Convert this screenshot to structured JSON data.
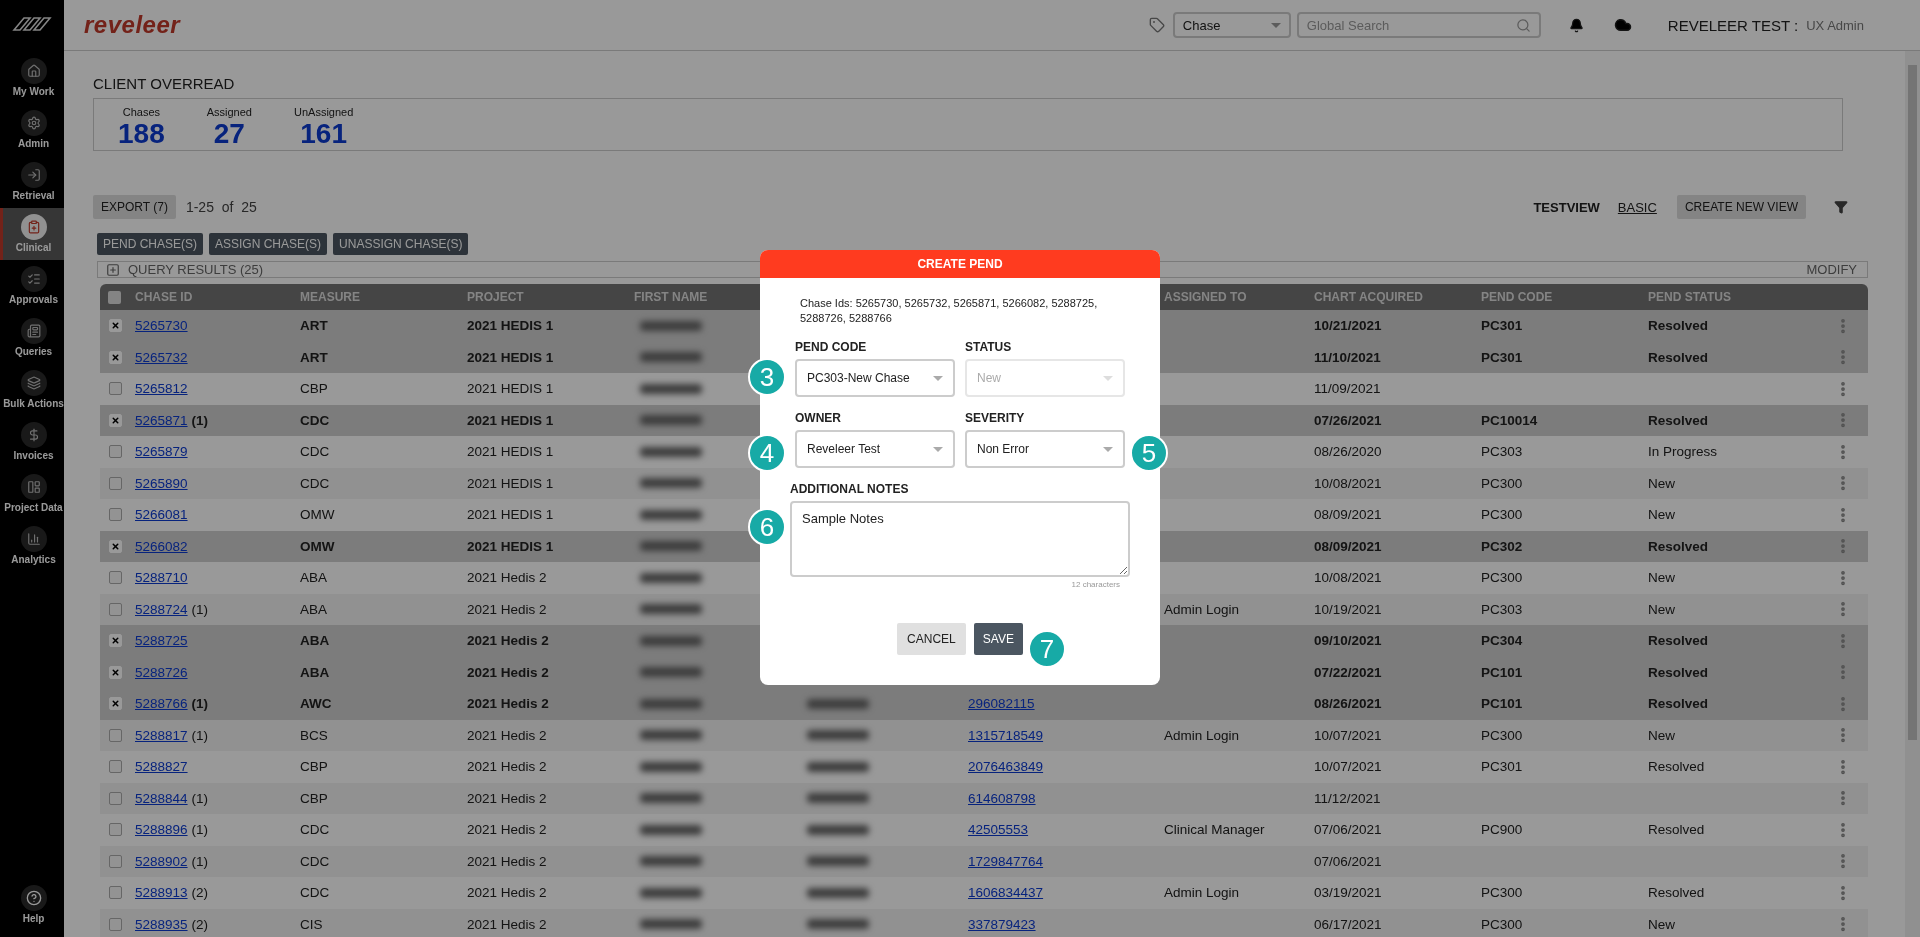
{
  "sidebar": {
    "items": [
      {
        "label": "My Work",
        "selected": false
      },
      {
        "label": "Admin",
        "selected": false
      },
      {
        "label": "Retrieval",
        "selected": false
      },
      {
        "label": "Clinical",
        "selected": true
      },
      {
        "label": "Approvals",
        "selected": false
      },
      {
        "label": "Queries",
        "selected": false
      },
      {
        "label": "Bulk Actions",
        "selected": false
      },
      {
        "label": "Invoices",
        "selected": false
      },
      {
        "label": "Project Data",
        "selected": false
      },
      {
        "label": "Analytics",
        "selected": false
      }
    ],
    "help": "Help"
  },
  "header": {
    "logo": "reveleer",
    "search_type": "Chase",
    "search_placeholder": "Global Search",
    "user": "REVELEER TEST :",
    "role": "UX Admin"
  },
  "page": {
    "title": "CLIENT OVERREAD",
    "stats": [
      {
        "label": "Chases",
        "value": "188"
      },
      {
        "label": "Assigned",
        "value": "27"
      },
      {
        "label": "UnAssigned",
        "value": "161"
      }
    ]
  },
  "toolbar": {
    "export": "EXPORT (7)",
    "range": "1-25  of  25",
    "view_name": "TESTVIEW",
    "view_link": "BASIC",
    "create_view": "CREATE NEW VIEW"
  },
  "actions": [
    "PEND CHASE(S)",
    "ASSIGN CHASE(S)",
    "UNASSIGN CHASE(S)"
  ],
  "query": {
    "title": "QUERY RESULTS (25)",
    "modify": "MODIFY"
  },
  "table": {
    "all_selected": false,
    "columns": [
      "CHASE ID",
      "MEASURE",
      "PROJECT",
      "FIRST NAME",
      "ASSIGNED TO",
      "CHART ACQUIRED",
      "PEND CODE",
      "PEND STATUS"
    ],
    "rows": [
      {
        "id": "5265730",
        "measure": "ART",
        "project": "2021 HEDIS 1",
        "chart": "10/21/2021",
        "pend_code": "PC301",
        "pend_status": "Resolved",
        "selected": true,
        "covered": true
      },
      {
        "id": "5265732",
        "measure": "ART",
        "project": "2021 HEDIS 1",
        "chart": "11/10/2021",
        "pend_code": "PC301",
        "pend_status": "Resolved",
        "selected": true,
        "covered": true
      },
      {
        "id": "5265812",
        "measure": "CBP",
        "project": "2021 HEDIS 1",
        "chart": "11/09/2021",
        "selected": false,
        "covered": true
      },
      {
        "id": "5265871",
        "count": "(1)",
        "measure": "CDC",
        "project": "2021 HEDIS 1",
        "chart": "07/26/2021",
        "pend_code": "PC10014",
        "pend_status": "Resolved",
        "selected": true,
        "covered": true
      },
      {
        "id": "5265879",
        "measure": "CDC",
        "project": "2021 HEDIS 1",
        "chart": "08/26/2020",
        "pend_code": "PC303",
        "pend_status": "In Progress",
        "selected": false,
        "covered": true
      },
      {
        "id": "5265890",
        "measure": "CDC",
        "project": "2021 HEDIS 1",
        "chart": "10/08/2021",
        "pend_code": "PC300",
        "pend_status": "New",
        "selected": false,
        "covered": true
      },
      {
        "id": "5266081",
        "measure": "OMW",
        "project": "2021 HEDIS 1",
        "chart": "08/09/2021",
        "pend_code": "PC300",
        "pend_status": "New",
        "selected": false,
        "covered": true
      },
      {
        "id": "5266082",
        "measure": "OMW",
        "project": "2021 HEDIS 1",
        "chart": "08/09/2021",
        "pend_code": "PC302",
        "pend_status": "Resolved",
        "selected": true,
        "covered": true
      },
      {
        "id": "5288710",
        "measure": "ABA",
        "project": "2021 Hedis 2",
        "chart": "10/08/2021",
        "pend_code": "PC300",
        "pend_status": "New",
        "selected": false,
        "covered": true
      },
      {
        "id": "5288724",
        "count": "(1)",
        "measure": "ABA",
        "project": "2021 Hedis 2",
        "assigned": "Admin Login",
        "chart": "10/19/2021",
        "pend_code": "PC303",
        "pend_status": "New",
        "selected": false,
        "covered": true
      },
      {
        "id": "5288725",
        "measure": "ABA",
        "project": "2021 Hedis 2",
        "chart": "09/10/2021",
        "pend_code": "PC304",
        "pend_status": "Resolved",
        "selected": true,
        "covered": true
      },
      {
        "id": "5288726",
        "measure": "ABA",
        "project": "2021 Hedis 2",
        "chart": "07/22/2021",
        "pend_code": "PC101",
        "pend_status": "Resolved",
        "selected": true
      },
      {
        "id": "5288766",
        "count": "(1)",
        "measure": "AWC",
        "project": "2021 Hedis 2",
        "member_id": "296082115",
        "chart": "08/26/2021",
        "pend_code": "PC101",
        "pend_status": "Resolved",
        "selected": true
      },
      {
        "id": "5288817",
        "count": "(1)",
        "measure": "BCS",
        "project": "2021 Hedis 2",
        "member_id": "1315718549",
        "assigned": "Admin Login",
        "chart": "10/07/2021",
        "pend_code": "PC300",
        "pend_status": "New",
        "selected": false
      },
      {
        "id": "5288827",
        "measure": "CBP",
        "project": "2021 Hedis 2",
        "member_id": "2076463849",
        "chart": "10/07/2021",
        "pend_code": "PC301",
        "pend_status": "Resolved",
        "selected": false
      },
      {
        "id": "5288844",
        "count": "(1)",
        "measure": "CBP",
        "project": "2021 Hedis 2",
        "member_id": "614608798",
        "chart": "11/12/2021",
        "selected": false
      },
      {
        "id": "5288896",
        "count": "(1)",
        "measure": "CDC",
        "project": "2021 Hedis 2",
        "member_id": "42505553",
        "assigned": "Clinical Manager",
        "chart": "07/06/2021",
        "pend_code": "PC900",
        "pend_status": "Resolved",
        "selected": false
      },
      {
        "id": "5288902",
        "count": "(1)",
        "measure": "CDC",
        "project": "2021 Hedis 2",
        "member_id": "1729847764",
        "chart": "07/06/2021",
        "selected": false
      },
      {
        "id": "5288913",
        "count": "(2)",
        "measure": "CDC",
        "project": "2021 Hedis 2",
        "member_id": "1606834437",
        "assigned": "Admin Login",
        "chart": "03/19/2021",
        "pend_code": "PC300",
        "pend_status": "Resolved",
        "selected": false
      },
      {
        "id": "5288935",
        "count": "(2)",
        "measure": "CIS",
        "project": "2021 Hedis 2",
        "member_id": "337879423",
        "chart": "06/17/2021",
        "pend_code": "PC300",
        "pend_status": "New",
        "selected": false
      }
    ]
  },
  "modal": {
    "title": "CREATE PEND",
    "chase_ids": "Chase Ids: 5265730, 5265732, 5265871, 5266082, 5288725, 5288726, 5288766",
    "fields": [
      {
        "label": "PEND CODE",
        "value": "PC303-New Chase",
        "disabled": false
      },
      {
        "label": "STATUS",
        "value": "New",
        "disabled": true
      },
      {
        "label": "OWNER",
        "value": "Reveleer Test",
        "disabled": false
      },
      {
        "label": "SEVERITY",
        "value": "Non Error",
        "disabled": false
      }
    ],
    "notes": {
      "label": "ADDITIONAL NOTES",
      "value": "Sample Notes",
      "count": "12 characters"
    },
    "buttons": [
      {
        "label": "CANCEL",
        "kind": "secondary"
      },
      {
        "label": "SAVE",
        "kind": "primary"
      }
    ]
  },
  "callouts": [
    "3",
    "4",
    "5",
    "6",
    "7"
  ]
}
